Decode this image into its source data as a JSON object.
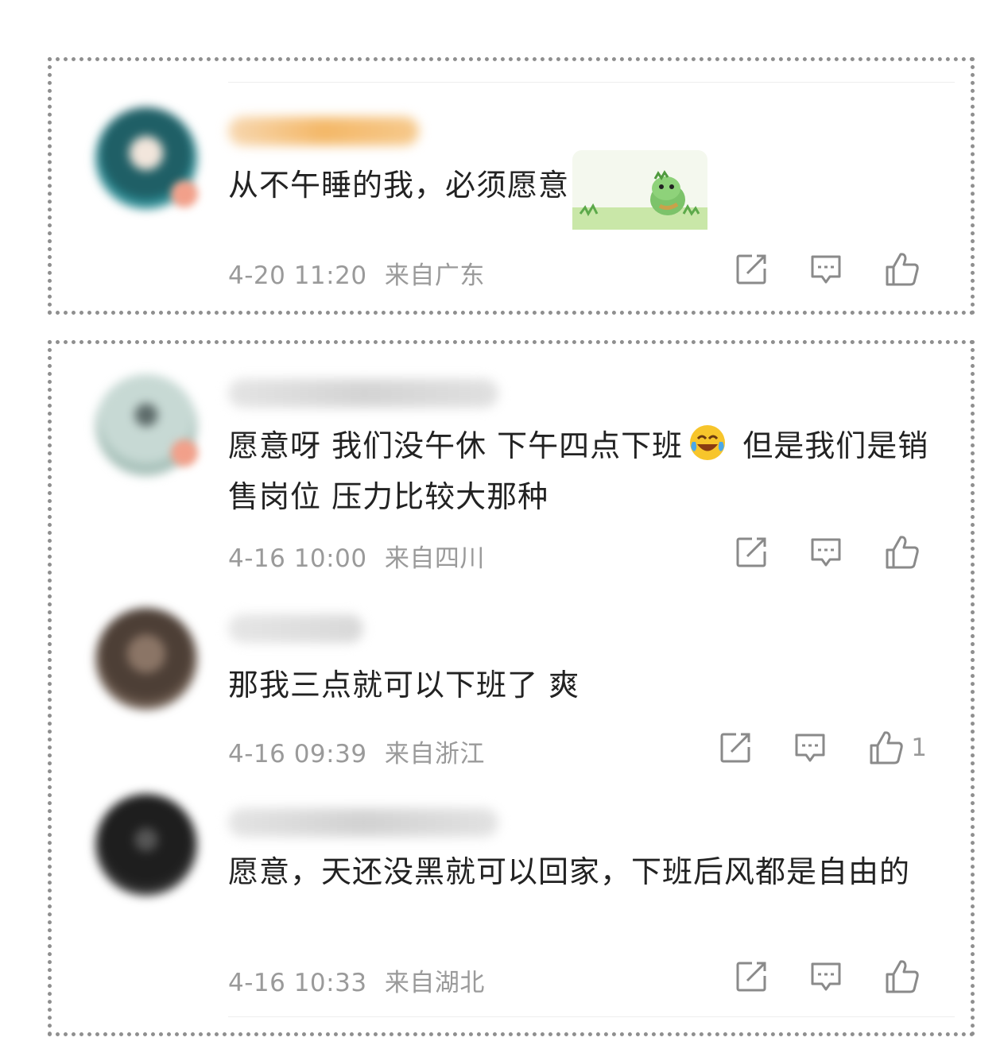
{
  "comments": [
    {
      "text": "从不午睡的我，必须愿意",
      "time": "4-20 11:20",
      "location": "来自广东",
      "like_count": "",
      "avatar_color": "#2f7f86",
      "has_sticker": true
    },
    {
      "text_before_emoji": "愿意呀  我们没午休  下午四点下班",
      "emoji": "laugh-cry-emoji",
      "text_after_emoji": " 但是我们是销售岗位  压力比较大那种",
      "time": "4-16 10:00",
      "location": "来自四川",
      "like_count": "",
      "avatar_color": "#9fb7b1"
    },
    {
      "text": "那我三点就可以下班了 爽",
      "time": "4-16 09:39",
      "location": "来自浙江",
      "like_count": "1",
      "avatar_color": "#5a4a40"
    },
    {
      "text": "愿意，天还没黑就可以回家，下班后风都是自由的",
      "time": "4-16 10:33",
      "location": "来自湖北",
      "like_count": "",
      "avatar_color": "#2a2a2a"
    }
  ],
  "icons": {
    "share": "share-icon",
    "comment": "comment-icon",
    "like": "thumbs-up-icon"
  }
}
